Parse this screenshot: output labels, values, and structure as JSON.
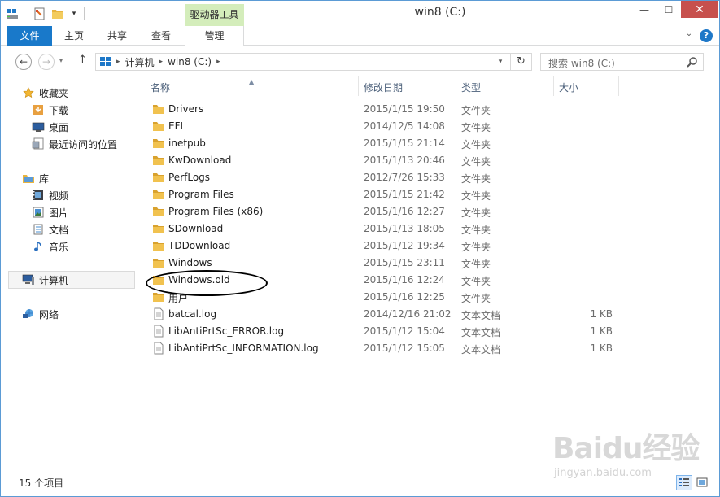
{
  "titlebar": {
    "title": "win8 (C:)",
    "context_group": "驱动器工具",
    "minimize_glyph": "—",
    "maximize_glyph": "☐",
    "close_glyph": "✕"
  },
  "ribbon": {
    "tabs": [
      "文件",
      "主页",
      "共享",
      "查看",
      "管理"
    ],
    "expand_glyph": "⌄",
    "help_glyph": "?"
  },
  "address": {
    "breadcrumb": [
      "计算机",
      "win8 (C:)"
    ],
    "search_placeholder": "搜索 win8 (C:)"
  },
  "navpane": {
    "favorites": {
      "label": "收藏夹",
      "items": [
        "下载",
        "桌面",
        "最近访问的位置"
      ]
    },
    "libraries": {
      "label": "库",
      "items": [
        "视频",
        "图片",
        "文档",
        "音乐"
      ]
    },
    "computer": "计算机",
    "network": "网络"
  },
  "columns": {
    "name": "名称",
    "date": "修改日期",
    "type": "类型",
    "size": "大小"
  },
  "files": [
    {
      "name": "Drivers",
      "date": "2015/1/15 19:50",
      "type": "文件夹",
      "size": "",
      "kind": "folder"
    },
    {
      "name": "EFI",
      "date": "2014/12/5 14:08",
      "type": "文件夹",
      "size": "",
      "kind": "folder"
    },
    {
      "name": "inetpub",
      "date": "2015/1/15 21:14",
      "type": "文件夹",
      "size": "",
      "kind": "folder"
    },
    {
      "name": "KwDownload",
      "date": "2015/1/13 20:46",
      "type": "文件夹",
      "size": "",
      "kind": "folder"
    },
    {
      "name": "PerfLogs",
      "date": "2012/7/26 15:33",
      "type": "文件夹",
      "size": "",
      "kind": "folder"
    },
    {
      "name": "Program Files",
      "date": "2015/1/15 21:42",
      "type": "文件夹",
      "size": "",
      "kind": "folder"
    },
    {
      "name": "Program Files (x86)",
      "date": "2015/1/16 12:27",
      "type": "文件夹",
      "size": "",
      "kind": "folder"
    },
    {
      "name": "SDownload",
      "date": "2015/1/13 18:05",
      "type": "文件夹",
      "size": "",
      "kind": "folder"
    },
    {
      "name": "TDDownload",
      "date": "2015/1/12 19:34",
      "type": "文件夹",
      "size": "",
      "kind": "folder"
    },
    {
      "name": "Windows",
      "date": "2015/1/15 23:11",
      "type": "文件夹",
      "size": "",
      "kind": "folder"
    },
    {
      "name": "Windows.old",
      "date": "2015/1/16 12:24",
      "type": "文件夹",
      "size": "",
      "kind": "folder"
    },
    {
      "name": "用户",
      "date": "2015/1/16 12:25",
      "type": "文件夹",
      "size": "",
      "kind": "folder"
    },
    {
      "name": "batcal.log",
      "date": "2014/12/16 21:02",
      "type": "文本文档",
      "size": "1 KB",
      "kind": "file"
    },
    {
      "name": "LibAntiPrtSc_ERROR.log",
      "date": "2015/1/12 15:04",
      "type": "文本文档",
      "size": "1 KB",
      "kind": "file"
    },
    {
      "name": "LibAntiPrtSc_INFORMATION.log",
      "date": "2015/1/12 15:05",
      "type": "文本文档",
      "size": "1 KB",
      "kind": "file"
    }
  ],
  "status": {
    "item_count": "15 个项目"
  },
  "watermark": {
    "logo": "Baidu经验",
    "url": "jingyan.baidu.com"
  },
  "colors": {
    "accent": "#1979ca",
    "context_tab": "#d4edbb",
    "close": "#c7504d",
    "folder": "#e8b440"
  }
}
